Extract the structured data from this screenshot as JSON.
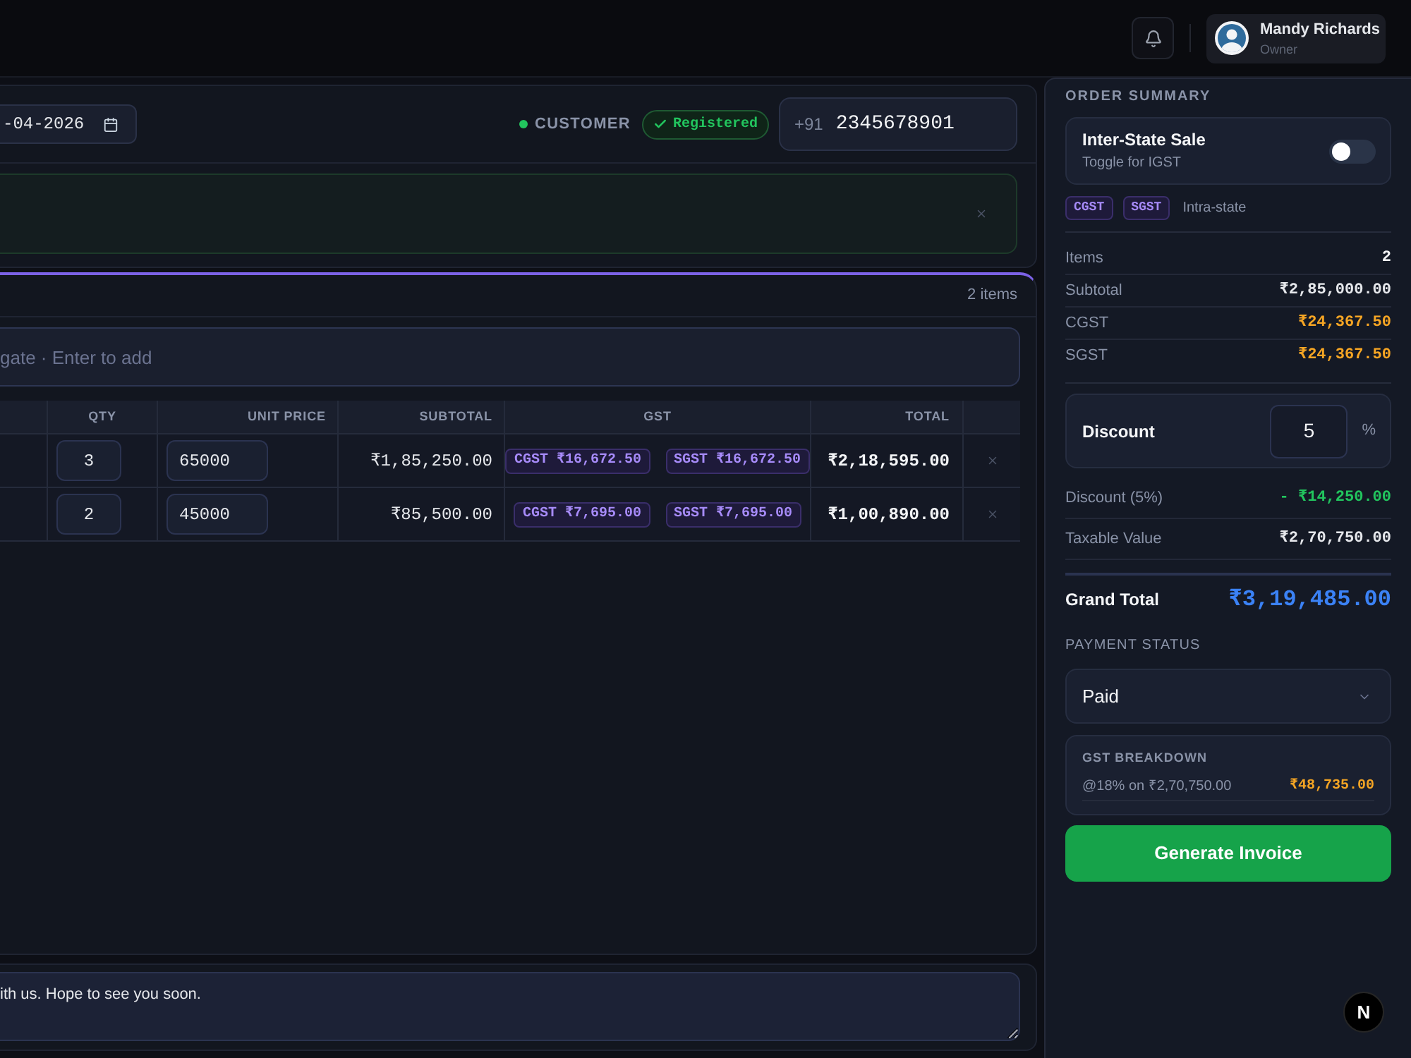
{
  "header": {
    "user": {
      "name": "Mandy Richards",
      "role": "Owner"
    }
  },
  "invoice": {
    "date": "-04-2026",
    "customer": {
      "label": "CUSTOMER",
      "status": "Registered"
    },
    "phone": {
      "prefix": "+91",
      "value": "2345678901"
    }
  },
  "items": {
    "count": "2 items",
    "search": {
      "placeholder": "gate · Enter to add"
    },
    "columns": [
      "QTY",
      "UNIT PRICE",
      "SUBTOTAL",
      "GST",
      "TOTAL"
    ],
    "rows": [
      {
        "qty": "3",
        "unit_price": "65000",
        "subtotal": "₹1,85,250.00",
        "taxes": [
          "CGST ₹16,672.50",
          "SGST ₹16,672.50"
        ],
        "total": "₹2,18,595.00"
      },
      {
        "qty": "2",
        "unit_price": "45000",
        "subtotal": "₹85,500.00",
        "taxes": [
          "CGST ₹7,695.00",
          "SGST ₹7,695.00"
        ],
        "total": "₹1,00,890.00"
      }
    ]
  },
  "summary": {
    "title": "ORDER SUMMARY",
    "inter_state": {
      "label": "Inter-State Sale",
      "hint": "Toggle for IGST",
      "on": false
    },
    "tax_tags": [
      "CGST",
      "SGST"
    ],
    "tax_mode": "Intra-state",
    "lines": [
      {
        "label": "Items",
        "value": "2",
        "kind": "count"
      },
      {
        "label": "Subtotal",
        "value": "₹2,85,000.00",
        "kind": "amount"
      },
      {
        "label": "CGST",
        "value": "₹24,367.50",
        "kind": "tax"
      },
      {
        "label": "SGST",
        "value": "₹24,367.50",
        "kind": "tax"
      }
    ],
    "discount": {
      "label": "Discount",
      "value": "5",
      "unit": "%"
    },
    "adjustments": [
      {
        "label": "Discount (5%)",
        "value": "- ₹14,250.00",
        "kind": "discount"
      },
      {
        "label": "Taxable Value",
        "value": "₹2,70,750.00",
        "kind": "amount"
      }
    ],
    "grand_total": {
      "label": "Grand Total",
      "value": "₹3,19,485.00"
    },
    "payment_status": {
      "label": "PAYMENT STATUS",
      "value": "Paid"
    },
    "gst_breakdown": {
      "title": "GST BREAKDOWN",
      "rows": [
        {
          "label": "@18% on ₹2,70,750.00",
          "value": "₹48,735.00"
        }
      ]
    },
    "action": "Generate Invoice"
  },
  "notes": {
    "value": "ith us. Hope to see you soon."
  },
  "dev_badge": "N"
}
